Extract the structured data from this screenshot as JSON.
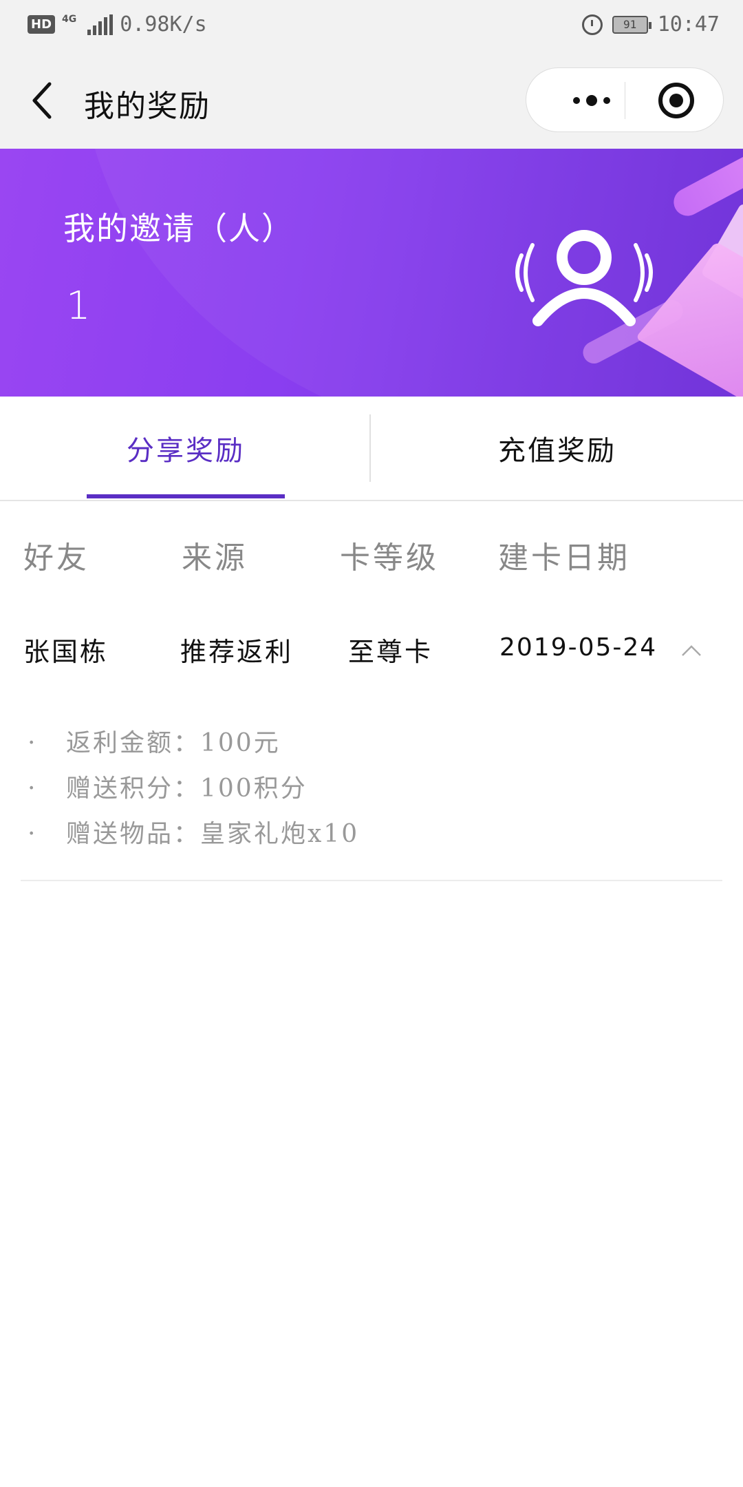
{
  "status_bar": {
    "hd": "HD",
    "network": "4G",
    "speed": "0.98K/s",
    "battery": "91",
    "time": "10:47"
  },
  "nav": {
    "title": "我的奖励"
  },
  "banner": {
    "label": "我的邀请（人）",
    "count": "1"
  },
  "tabs": {
    "share": "分享奖励",
    "recharge": "充值奖励",
    "active": "share"
  },
  "table": {
    "headers": [
      "好友",
      "来源",
      "卡等级",
      "建卡日期"
    ],
    "row": {
      "friend": "张国栋",
      "source": "推荐返利",
      "level": "至尊卡",
      "date": "2019-05-24"
    }
  },
  "details": [
    {
      "bullet": "·",
      "text": "返利金额：100元"
    },
    {
      "bullet": "·",
      "text": "赠送积分：100积分"
    },
    {
      "bullet": "·",
      "text": "赠送物品：皇家礼炮x10"
    }
  ],
  "colors": {
    "accent": "#5a2ec4",
    "banner_start": "#9a46f2",
    "banner_end": "#6a2ad8"
  }
}
